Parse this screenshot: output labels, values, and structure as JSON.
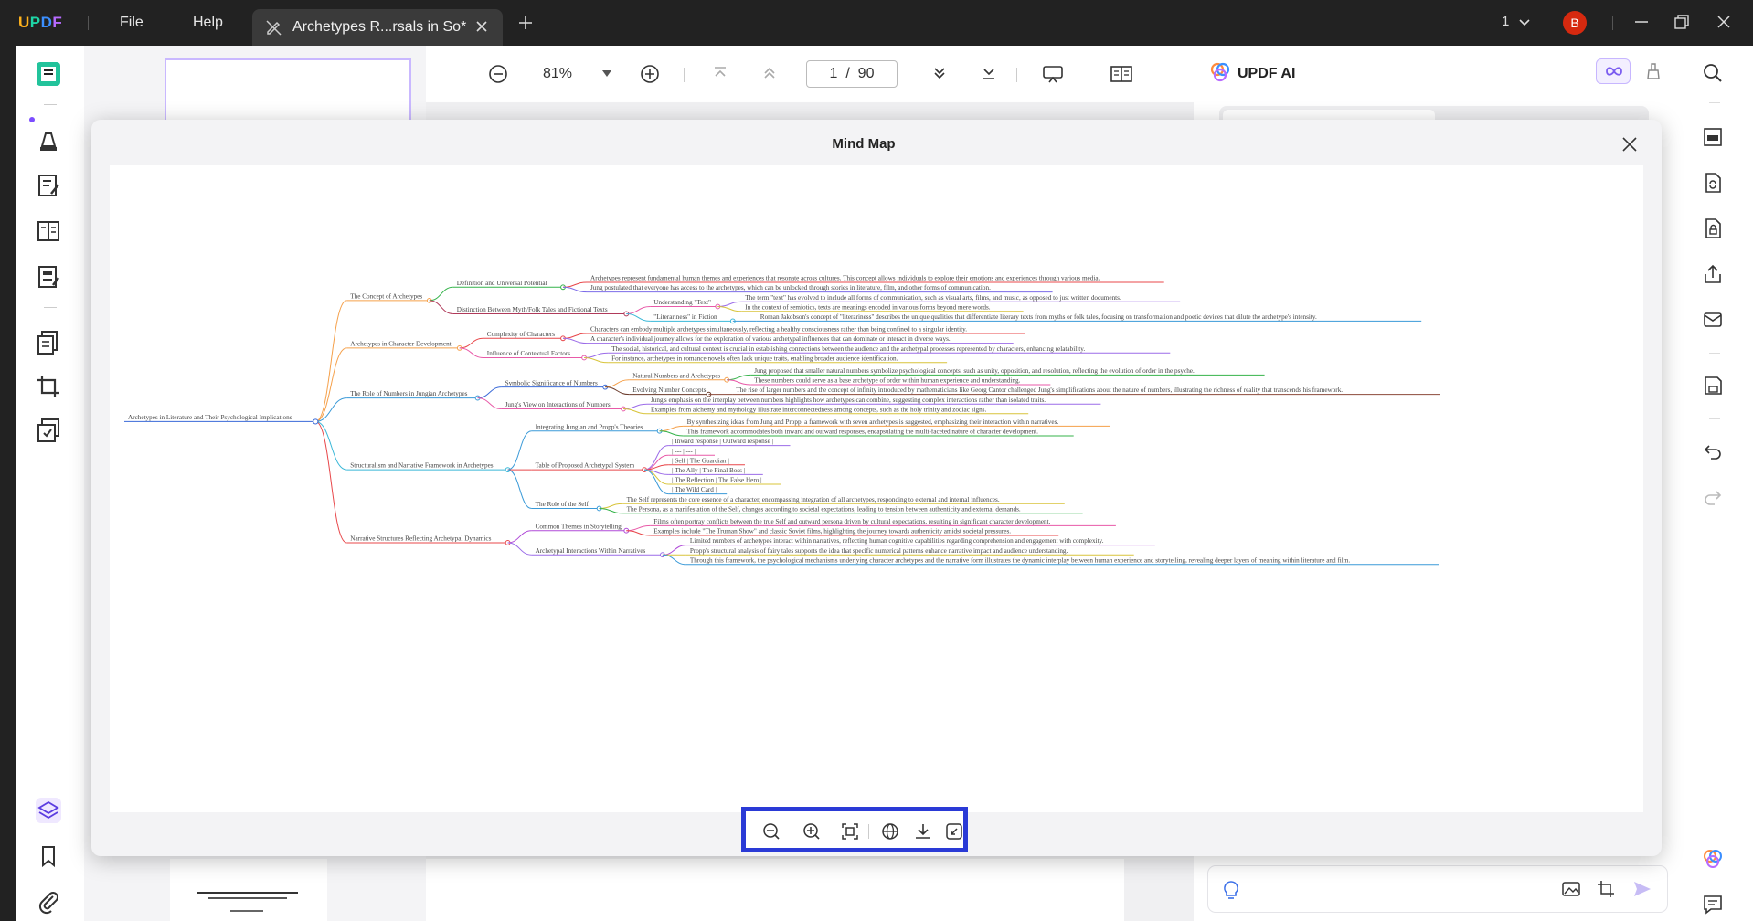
{
  "titlebar": {
    "menu": [
      "File",
      "Help"
    ],
    "tab_title": "Archetypes R...rsals in So*",
    "page_count": "1",
    "avatar_letter": "B"
  },
  "doc_toolbar": {
    "zoom": "81%",
    "page_current": "1",
    "page_sep": "/",
    "page_total": "90"
  },
  "ai_panel": {
    "title": "UPDF AI"
  },
  "modal": {
    "title": "Mind Map"
  },
  "mindmap": {
    "root": "Archetypes in Literature and Their Psychological Implications",
    "branches": [
      {
        "label": "The Concept of Archetypes",
        "color": "#f5a04a",
        "children": [
          {
            "label": "Definition and Universal Potential",
            "color": "#34b34a",
            "children": [
              {
                "label": "Archetypes represent fundamental human themes and experiences that resonate across cultures. This concept allows individuals to explore their emotions and experiences through various media.",
                "color": "#e8474a"
              },
              {
                "label": "Jung postulated that everyone has access to the archetypes, which can be unlocked through stories in literature, film, and other forms of communication.",
                "color": "#7c6be8"
              }
            ]
          },
          {
            "label": "Distinction Between Myth/Folk Tales and Fictional Texts",
            "color": "#b03a5a",
            "children": [
              {
                "label": "Understanding \"Text\"",
                "color": "#e85aa8",
                "children": [
                  {
                    "label": "The term \"text\" has evolved to include all forms of communication, such as visual arts, films, and music, as opposed to just written documents.",
                    "color": "#9b6be8"
                  },
                  {
                    "label": "In the context of semiotics, texts are meanings encoded in various forms beyond mere words.",
                    "color": "#d8c43a"
                  }
                ]
              },
              {
                "label": "\"Literariness\" in Fiction",
                "color": "#3ab8d8",
                "children": [
                  {
                    "label": "Roman Jakobson's concept of \"literariness\" describes the unique qualities that differentiate literary texts from myths or folk tales, focusing on transformation and poetic devices that dilute the archetype's intensity.",
                    "color": "#3a9ad8"
                  }
                ]
              }
            ]
          }
        ]
      },
      {
        "label": "Archetypes in Character Development",
        "color": "#f5a04a",
        "children": [
          {
            "label": "Complexity of Characters",
            "color": "#e8474a",
            "children": [
              {
                "label": "Characters can embody multiple archetypes simultaneously, reflecting a healthy consciousness rather than being confined to a singular identity.",
                "color": "#e8474a"
              },
              {
                "label": "A character's individual journey allows for the exploration of various archetypal influences that can dominate or interact in diverse ways.",
                "color": "#9b6be8"
              }
            ]
          },
          {
            "label": "Influence of Contextual Factors",
            "color": "#e85aa8",
            "children": [
              {
                "label": "The social, historical, and cultural context is crucial in establishing connections between the audience and the archetypal processes represented by characters, enhancing relatability.",
                "color": "#9b6be8"
              },
              {
                "label": "For instance, archetypes in romance novels often lack unique traits, enabling broader audience identification.",
                "color": "#d8c43a"
              }
            ]
          }
        ]
      },
      {
        "label": "The Role of Numbers in Jungian Archetypes",
        "color": "#3a9ad8",
        "children": [
          {
            "label": "Symbolic Significance of Numbers",
            "color": "#3a6ad8",
            "children": [
              {
                "label": "Natural Numbers and Archetypes",
                "color": "#f5a04a",
                "children": [
                  {
                    "label": "Jung proposed that smaller natural numbers symbolize psychological concepts, such as unity, opposition, and resolution, reflecting the evolution of order in the psyche.",
                    "color": "#34b34a"
                  },
                  {
                    "label": "These numbers could serve as a base archetype of order within human experience and understanding.",
                    "color": "#e85aa8"
                  }
                ]
              },
              {
                "label": "Evolving Number Concepts",
                "color": "#6a3a2a",
                "children": [
                  {
                    "label": "The rise of larger numbers and the concept of infinity introduced by mathematicians like Georg Cantor challenged Jung's simplifications about the nature of numbers, illustrating the richness of reality that transcends his framework.",
                    "color": "#8b4a3a"
                  }
                ]
              }
            ]
          },
          {
            "label": "Jung's View on Interactions of Numbers",
            "color": "#e85aa8",
            "children": [
              {
                "label": "Jung's emphasis on the interplay between numbers highlights how archetypes can combine, suggesting complex interactions rather than isolated traits.",
                "color": "#9b6be8"
              },
              {
                "label": "Examples from alchemy and mythology illustrate interconnectedness among concepts, such as the holy trinity and zodiac signs.",
                "color": "#d8c43a"
              }
            ]
          }
        ]
      },
      {
        "label": "Structuralism and Narrative Framework in Archetypes",
        "color": "#3ab8d8",
        "children": [
          {
            "label": "Integrating Jungian and Propp's Theories",
            "color": "#3a9ad8",
            "children": [
              {
                "label": "By synthesizing ideas from Jung and Propp, a framework with seven archetypes is suggested, emphasizing their interaction within narratives.",
                "color": "#f5a04a"
              },
              {
                "label": "This framework accommodates both inward and outward responses, encapsulating the multi-faceted nature of character development.",
                "color": "#34b34a"
              }
            ]
          },
          {
            "label": "Table of Proposed Archetypal System",
            "color": "#e8474a",
            "children": [
              {
                "label": "| Inward response | Outward response |",
                "color": "#9b6be8"
              },
              {
                "label": "| --- | --- |",
                "color": "#e85aa8"
              },
              {
                "label": "| Self | The Guardian |",
                "color": "#e8474a"
              },
              {
                "label": "| The Ally | The Final Boss |",
                "color": "#9b6be8"
              },
              {
                "label": "| The Reflection | The False Hero |",
                "color": "#d8c43a"
              },
              {
                "label": "| The Wild Card |",
                "color": "#3a9ad8"
              }
            ]
          },
          {
            "label": "The Role of the Self",
            "color": "#3a9ad8",
            "children": [
              {
                "label": "The Self represents the core essence of a character, encompassing integration of all archetypes, responding to external and internal influences.",
                "color": "#d8c43a"
              },
              {
                "label": "The Persona, as a manifestation of the Self, changes according to societal expectations, leading to tension between authenticity and external demands.",
                "color": "#34b34a"
              }
            ]
          }
        ]
      },
      {
        "label": "Narrative Structures Reflecting Archetypal Dynamics",
        "color": "#e8474a",
        "children": [
          {
            "label": "Common Themes in Storytelling",
            "color": "#b04ad8",
            "children": [
              {
                "label": "Films often portray conflicts between the true Self and outward persona driven by cultural expectations, resulting in significant character development.",
                "color": "#e85aa8"
              },
              {
                "label": "Examples include \"The Truman Show\" and classic Soviet films, highlighting the journey towards authenticity amidst societal pressures.",
                "color": "#e8474a"
              }
            ]
          },
          {
            "label": "Archetypal Interactions Within Narratives",
            "color": "#9b6be8",
            "children": [
              {
                "label": "Limited numbers of archetypes interact within narratives, reflecting human cognitive capabilities regarding comprehension and engagement with complexity.",
                "color": "#b04ad8"
              },
              {
                "label": "Propp's structural analysis of fairy tales supports the idea that specific numerical patterns enhance narrative impact and audience understanding.",
                "color": "#d8c43a"
              },
              {
                "label": "Through this framework, the psychological mechanisms underlying character archetypes and the narrative form illustrates the dynamic interplay between human experience and storytelling, revealing deeper layers of meaning within literature and film.",
                "color": "#3a9ad8"
              }
            ]
          }
        ]
      }
    ]
  }
}
